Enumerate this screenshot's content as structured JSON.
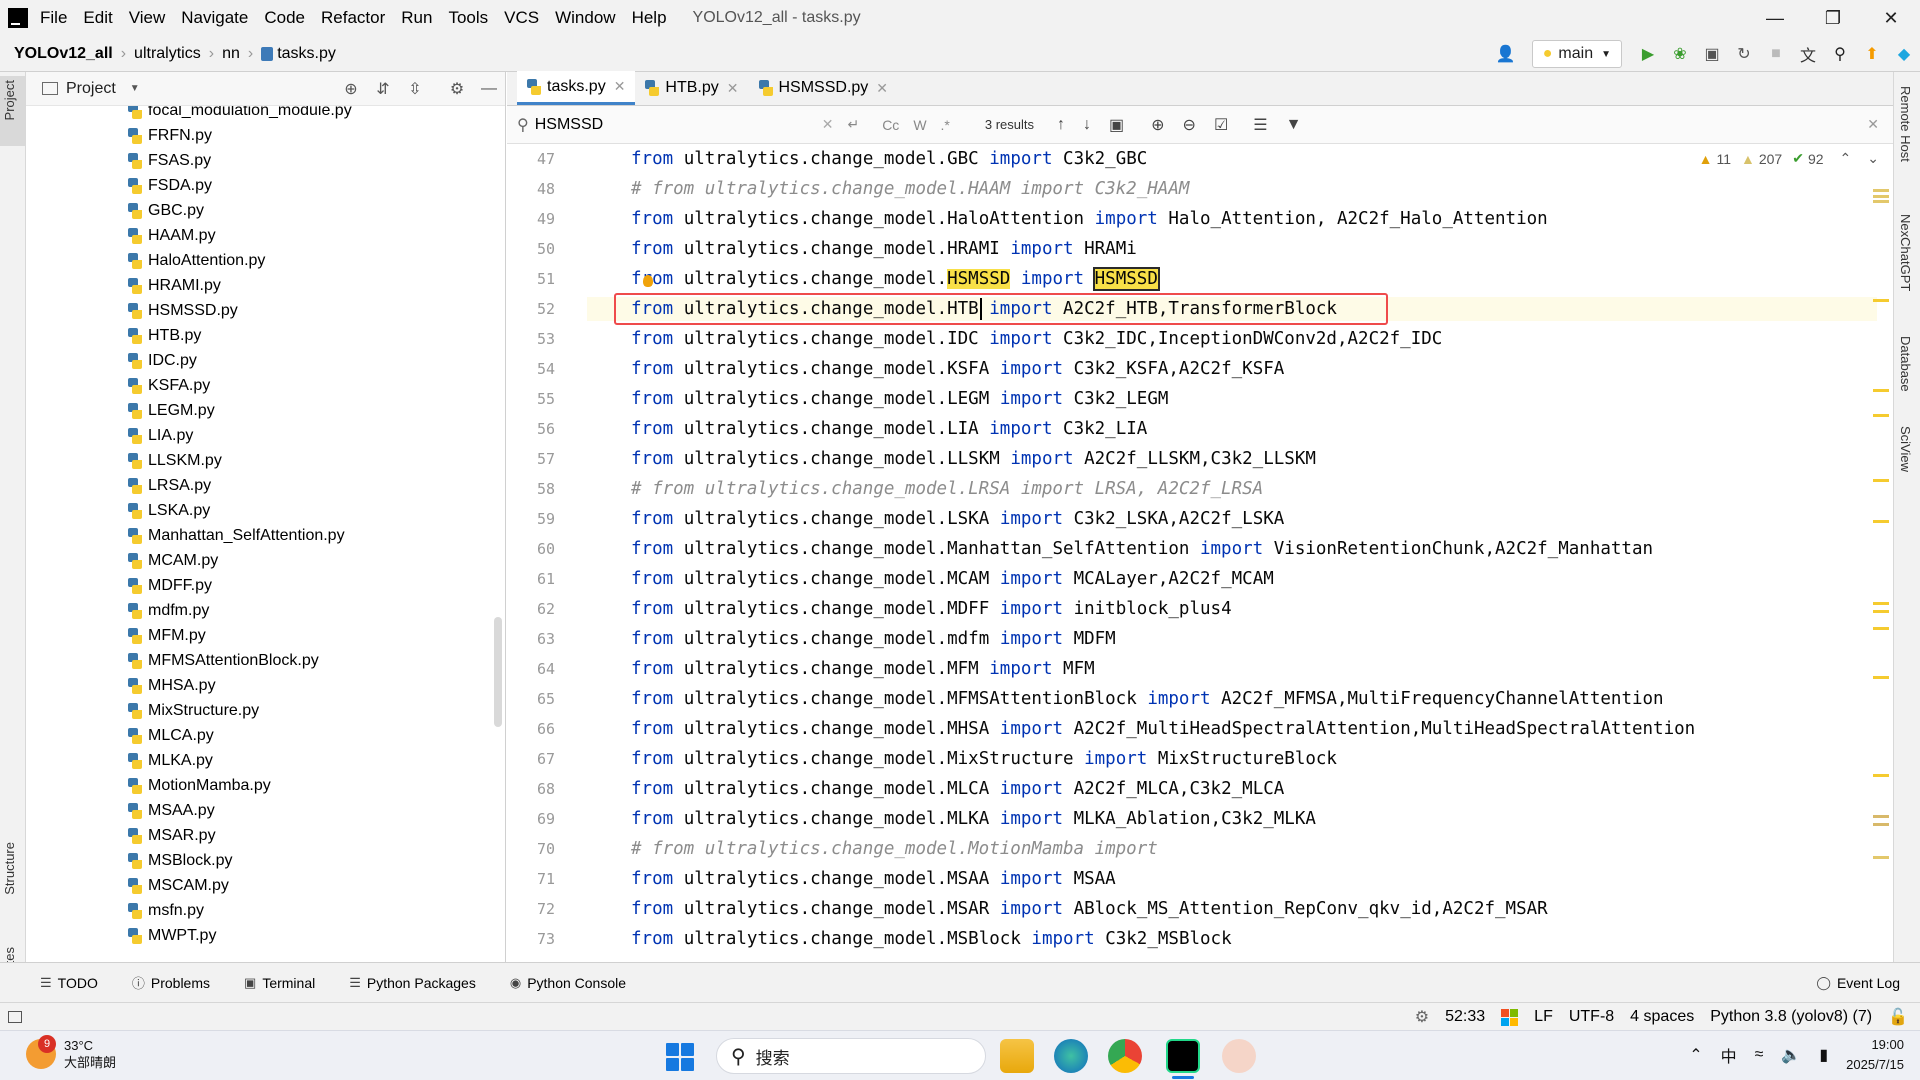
{
  "menu": {
    "items": [
      "File",
      "Edit",
      "View",
      "Navigate",
      "Code",
      "Refactor",
      "Run",
      "Tools",
      "VCS",
      "Window",
      "Help"
    ],
    "window_title": "YOLOv12_all - tasks.py"
  },
  "navbar": {
    "breadcrumb": [
      "YOLOv12_all",
      "ultralytics",
      "nn",
      "tasks.py"
    ],
    "branch": "main"
  },
  "left_strip": {
    "tabs": [
      "Project",
      "Structure",
      "Favorites"
    ]
  },
  "project_panel": {
    "title": "Project",
    "files": [
      "focal_modulation_module.py",
      "FRFN.py",
      "FSAS.py",
      "FSDA.py",
      "GBC.py",
      "HAAM.py",
      "HaloAttention.py",
      "HRAMI.py",
      "HSMSSD.py",
      "HTB.py",
      "IDC.py",
      "KSFA.py",
      "LEGM.py",
      "LIA.py",
      "LLSKM.py",
      "LRSA.py",
      "LSKA.py",
      "Manhattan_SelfAttention.py",
      "MCAM.py",
      "MDFF.py",
      "mdfm.py",
      "MFM.py",
      "MFMSAttentionBlock.py",
      "MHSA.py",
      "MixStructure.py",
      "MLCA.py",
      "MLKA.py",
      "MotionMamba.py",
      "MSAA.py",
      "MSAR.py",
      "MSBlock.py",
      "MSCAM.py",
      "msfn.py",
      "MWPT.py"
    ]
  },
  "editor": {
    "tabs": [
      "tasks.py",
      "HTB.py",
      "HSMSSD.py"
    ],
    "active_tab": "tasks.py",
    "find": {
      "query": "HSMSSD",
      "results": "3 results",
      "opt_case": "Cc",
      "opt_word": "W",
      "opt_regex": ".*"
    },
    "inspections": {
      "warnings": "11",
      "weak_warnings": "207",
      "typos": "92"
    },
    "line_numbers": [
      "47",
      "48",
      "49",
      "50",
      "51",
      "52",
      "53",
      "54",
      "55",
      "56",
      "57",
      "58",
      "59",
      "60",
      "61",
      "62",
      "63",
      "64",
      "65",
      "66",
      "67",
      "68",
      "69",
      "70",
      "71",
      "72",
      "73"
    ],
    "lines": [
      {
        "n": 47,
        "module": "GBC",
        "names": "C3k2_GBC"
      },
      {
        "n": 48,
        "comment": "# from ultralytics.change_model.HAAM import C3k2_HAAM"
      },
      {
        "n": 49,
        "module": "HaloAttention",
        "names": "Halo_Attention, A2C2f_Halo_Attention"
      },
      {
        "n": 50,
        "module": "HRAMI",
        "names": "HRAMi"
      },
      {
        "n": 51,
        "module": "HSMSSD",
        "names": "HSMSSD"
      },
      {
        "n": 52,
        "module": "HTB",
        "names": "A2C2f_HTB,TransformerBlock"
      },
      {
        "n": 53,
        "module": "IDC",
        "names": "C3k2_IDC,InceptionDWConv2d,A2C2f_IDC"
      },
      {
        "n": 54,
        "module": "KSFA",
        "names": "C3k2_KSFA,A2C2f_KSFA"
      },
      {
        "n": 55,
        "module": "LEGM",
        "names": "C3k2_LEGM"
      },
      {
        "n": 56,
        "module": "LIA",
        "names": "C3k2_LIA"
      },
      {
        "n": 57,
        "module": "LLSKM",
        "names": "A2C2f_LLSKM,C3k2_LLSKM"
      },
      {
        "n": 58,
        "comment": "# from ultralytics.change_model.LRSA import LRSA, A2C2f_LRSA"
      },
      {
        "n": 59,
        "module": "LSKA",
        "names": "C3k2_LSKA,A2C2f_LSKA"
      },
      {
        "n": 60,
        "module": "Manhattan_SelfAttention",
        "names": "VisionRetentionChunk,A2C2f_Manhattan"
      },
      {
        "n": 61,
        "module": "MCAM",
        "names": "MCALayer,A2C2f_MCAM"
      },
      {
        "n": 62,
        "module": "MDFF",
        "names": "initblock_plus4"
      },
      {
        "n": 63,
        "module": "mdfm",
        "names": "MDFM"
      },
      {
        "n": 64,
        "module": "MFM",
        "names": "MFM"
      },
      {
        "n": 65,
        "module": "MFMSAttentionBlock",
        "names": "A2C2f_MFMSA,MultiFrequencyChannelAttention"
      },
      {
        "n": 66,
        "module": "MHSA",
        "names": "A2C2f_MultiHeadSpectralAttention,MultiHeadSpectralAttention"
      },
      {
        "n": 67,
        "module": "MixStructure",
        "names": "MixStructureBlock"
      },
      {
        "n": 68,
        "module": "MLCA",
        "names": "A2C2f_MLCA,C3k2_MLCA"
      },
      {
        "n": 69,
        "module": "MLKA",
        "names": "MLKA_Ablation,C3k2_MLKA"
      },
      {
        "n": 70,
        "comment": "# from ultralytics.change_model.MotionMamba import"
      },
      {
        "n": 71,
        "module": "MSAA",
        "names": "MSAA"
      },
      {
        "n": 72,
        "module": "MSAR",
        "names": "ABlock_MS_Attention_RepConv_qkv_id,A2C2f_MSAR"
      },
      {
        "n": 73,
        "module": "MSBlock",
        "names": "C3k2_MSBlock"
      }
    ],
    "kw_from": "from",
    "kw_import": "import",
    "pkg_prefix": "ultralytics.change_model."
  },
  "right_strip": {
    "tabs": [
      "Remote Host",
      "NexChatGPT",
      "Database",
      "SciView"
    ]
  },
  "bottom_tabs": [
    "TODO",
    "Problems",
    "Terminal",
    "Python Packages",
    "Python Console"
  ],
  "event_log": "Event Log",
  "status": {
    "position": "52:33",
    "line_sep": "LF",
    "encoding": "UTF-8",
    "indent": "4 spaces",
    "interpreter": "Python 3.8 (yolov8) (7)"
  },
  "taskbar": {
    "weather_temp": "33°C",
    "weather_desc": "大部晴朗",
    "weather_badge": "9",
    "search_placeholder": "搜索",
    "ime": "中",
    "time": "19:00",
    "date": "2025/7/15"
  },
  "colors": {
    "keyword": "#0033b3",
    "comment": "#8c8c8c",
    "search_highlight": "#f8e047",
    "red_box": "#ef4b4b",
    "tab_underline": "#4083c9"
  }
}
